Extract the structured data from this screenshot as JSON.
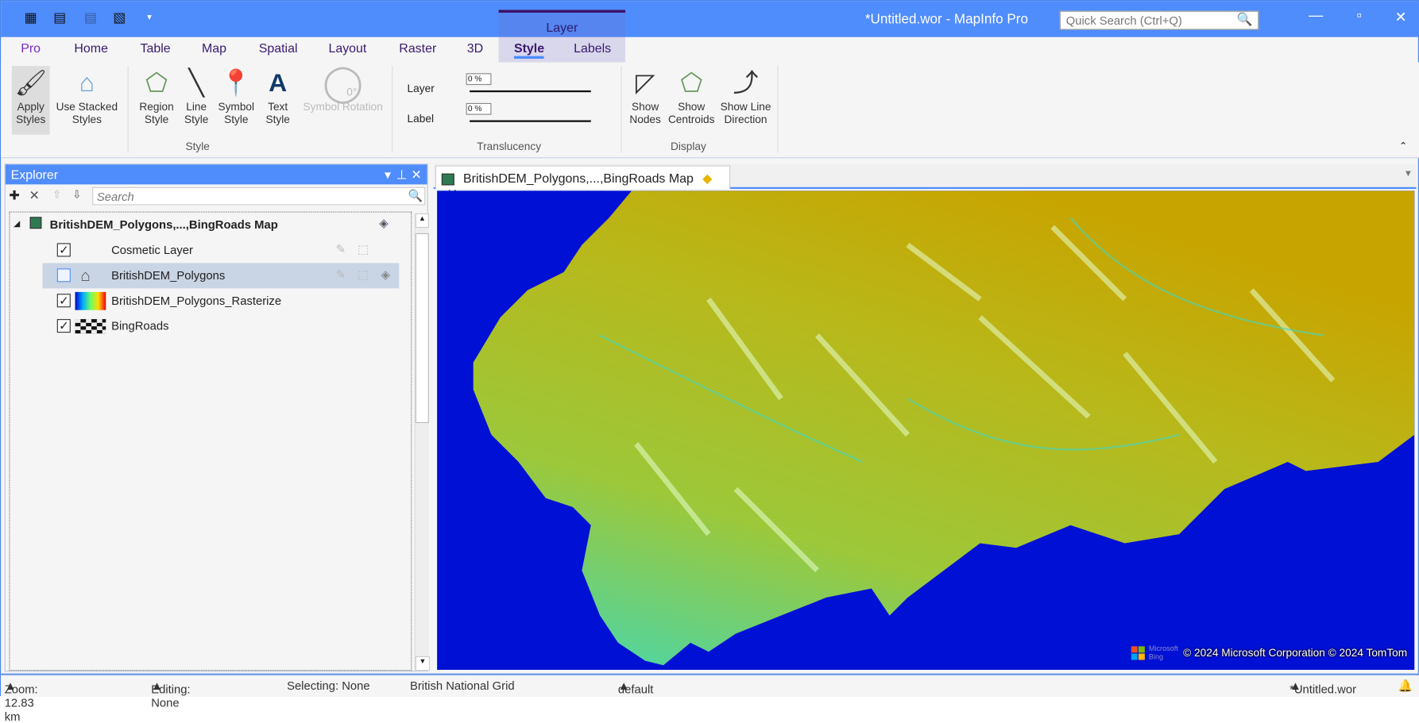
{
  "app": {
    "window_title": "*Untitled.wor - MapInfo Pro",
    "quick_search_placeholder": "Quick Search (Ctrl+Q)",
    "context_tab_group": "Layer"
  },
  "ribbon_tabs": [
    "Pro",
    "Home",
    "Table",
    "Map",
    "Spatial",
    "Layout",
    "Raster",
    "3D",
    "Style",
    "Labels"
  ],
  "active_tab": "Style",
  "ribbon": {
    "apply_styles": "Apply Styles",
    "use_stacked": "Use Stacked Styles",
    "region_style": "Region Style",
    "line_style": "Line Style",
    "symbol_style": "Symbol Style",
    "text_style": "Text Style",
    "symbol_rotation": "Symbol Rotation",
    "rotation_value": "0°",
    "style_group": "Style",
    "layer_label": "Layer",
    "label_label": "Label",
    "layer_translucency": "0 %",
    "label_translucency": "0 %",
    "layer_translucency_value": 0,
    "label_translucency_value": 0,
    "translucency_group": "Translucency",
    "show_nodes": "Show Nodes",
    "show_centroids": "Show Centroids",
    "show_line_direction": "Show Line Direction",
    "display_group": "Display"
  },
  "explorer": {
    "title": "Explorer",
    "search_placeholder": "Search",
    "map_name": "BritishDEM_Polygons,...,BingRoads Map",
    "layers": [
      {
        "name": "Cosmetic Layer",
        "checked": true
      },
      {
        "name": "BritishDEM_Polygons",
        "checked": false
      },
      {
        "name": "BritishDEM_Polygons_Rasterize",
        "checked": true
      },
      {
        "name": "BingRoads",
        "checked": true
      }
    ]
  },
  "map_tab": {
    "title": "BritishDEM_Polygons,...,BingRoads Map"
  },
  "map": {
    "attribution": "© 2024 Microsoft Corporation © 2024 TomTom",
    "logo_text": "Microsoft Bing",
    "water_color": "#0010d4"
  },
  "status": {
    "zoom": "Zoom: 12.83 km",
    "editing": "Editing: None",
    "selecting": "Selecting: None",
    "projection": "British National Grid",
    "style": "default",
    "workspace": "*Untitled.wor"
  }
}
